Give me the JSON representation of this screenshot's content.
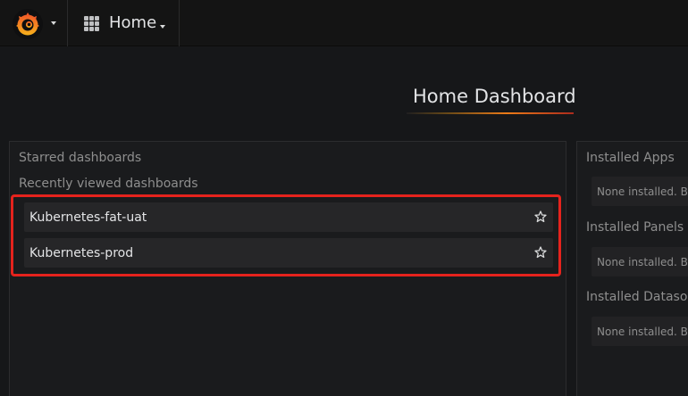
{
  "navbar": {
    "logo_icon": "grafana-logo-icon",
    "home_icon": "dashboard-grid-icon",
    "home_label": "Home"
  },
  "page": {
    "title": "Home Dashboard"
  },
  "left_panel": {
    "starred_heading": "Starred dashboards",
    "recent_heading": "Recently viewed dashboards",
    "recent_dashboards": [
      {
        "name": "Kubernetes-fat-uat",
        "icon": "star-outline-icon"
      },
      {
        "name": "Kubernetes-prod",
        "icon": "star-outline-icon"
      }
    ]
  },
  "right_panel": {
    "sections": [
      {
        "heading": "Installed Apps",
        "message": "None installed. Br"
      },
      {
        "heading": "Installed Panels",
        "message": "None installed. Br"
      },
      {
        "heading": "Installed Datasou",
        "message": "None installed. Br"
      }
    ]
  },
  "colors": {
    "background": "#161719",
    "navbar": "#141414",
    "panel": "#1a1b1d",
    "row": "#262628",
    "highlight": "#e5231d",
    "accent": "#eb7b18"
  }
}
